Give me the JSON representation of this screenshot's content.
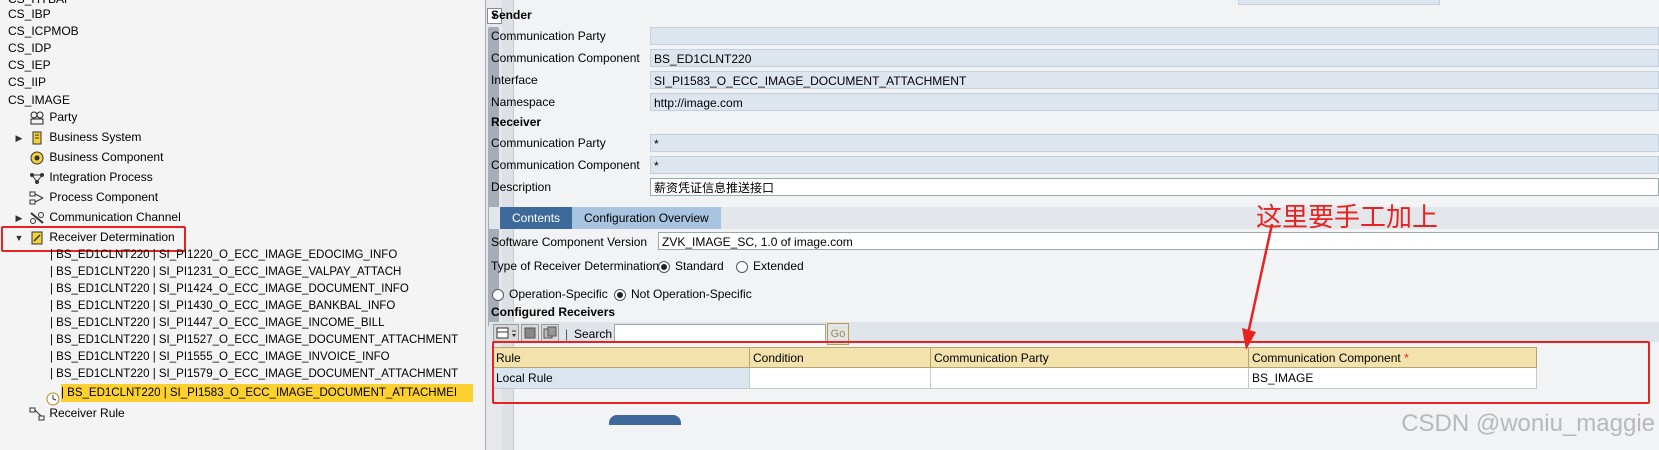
{
  "tree": {
    "cs_items": [
      "CS_IBP",
      "CS_ICPMOB",
      "CS_IDP",
      "CS_IEP",
      "CS_IIP",
      "CS_IMAGE"
    ],
    "top_partial": "CS_HYBAF",
    "nodes": [
      {
        "label": "Party",
        "icon": "party-icon",
        "toggle": ""
      },
      {
        "label": "Business System",
        "icon": "business-system-icon",
        "toggle": "▶"
      },
      {
        "label": "Business Component",
        "icon": "business-component-icon",
        "toggle": ""
      },
      {
        "label": "Integration Process",
        "icon": "integration-process-icon",
        "toggle": ""
      },
      {
        "label": "Process Component",
        "icon": "process-component-icon",
        "toggle": ""
      },
      {
        "label": "Communication Channel",
        "icon": "communication-channel-icon",
        "toggle": "▶"
      },
      {
        "label": "Receiver Determination",
        "icon": "receiver-determination-icon",
        "toggle": "▼"
      }
    ],
    "children": [
      "| BS_ED1CLNT220 | SI_PI1220_O_ECC_IMAGE_EDOCIMG_INFO",
      "| BS_ED1CLNT220 | SI_PI1231_O_ECC_IMAGE_VALPAY_ATTACH",
      "| BS_ED1CLNT220 | SI_PI1424_O_ECC_IMAGE_DOCUMENT_INFO",
      "| BS_ED1CLNT220 | SI_PI1430_O_ECC_IMAGE_BANKBAL_INFO",
      "| BS_ED1CLNT220 | SI_PI1447_O_ECC_IMAGE_INCOME_BILL",
      "| BS_ED1CLNT220 | SI_PI1527_O_ECC_IMAGE_DOCUMENT_ATTACHMENT",
      "| BS_ED1CLNT220 | SI_PI1555_O_ECC_IMAGE_INVOICE_INFO",
      "| BS_ED1CLNT220 | SI_PI1579_O_ECC_IMAGE_DOCUMENT_ATTACHMENT"
    ],
    "selected": "| BS_ED1CLNT220 | SI_PI1583_O_ECC_IMAGE_DOCUMENT_ATTACHMEI",
    "receiver_rule": "Receiver Rule"
  },
  "sender": {
    "title": "Sender",
    "comm_party_label": "Communication Party",
    "comm_party": "",
    "comm_component_label": "Communication Component",
    "comm_component": "BS_ED1CLNT220",
    "interface_label": "Interface",
    "interface": "SI_PI1583_O_ECC_IMAGE_DOCUMENT_ATTACHMENT",
    "namespace_label": "Namespace",
    "namespace": "http://image.com"
  },
  "receiver": {
    "title": "Receiver",
    "comm_party_label": "Communication Party",
    "comm_party": "*",
    "comm_component_label": "Communication Component",
    "comm_component": "*",
    "description_label": "Description",
    "description": "薪资凭证信息推送接口"
  },
  "tabs": [
    "Contents",
    "Configuration Overview"
  ],
  "config": {
    "scv_label": "Software Component Version",
    "scv": "ZVK_IMAGE_SC, 1.0 of image.com",
    "type_label": "Type of Receiver Determination",
    "type_standard": "Standard",
    "type_extended": "Extended",
    "op_specific": "Operation-Specific",
    "not_op_specific": "Not Operation-Specific",
    "configured_receivers": "Configured Receivers",
    "search_label": "Search",
    "go_label": "Go"
  },
  "grid": {
    "headers": [
      "Rule",
      "Condition",
      "Communication Party",
      "Communication Component"
    ],
    "required_mark": "*",
    "rows": [
      [
        "Local Rule",
        "",
        "",
        "BS_IMAGE"
      ]
    ]
  },
  "annotation": "这里要手工加上",
  "watermark": "CSDN @woniu_maggie",
  "colors": {
    "annotation_red": "#e8231f",
    "selection_yellow": "#fcd02f",
    "tab_blue": "#3d6a9a",
    "field_blue": "#dde6ef"
  }
}
